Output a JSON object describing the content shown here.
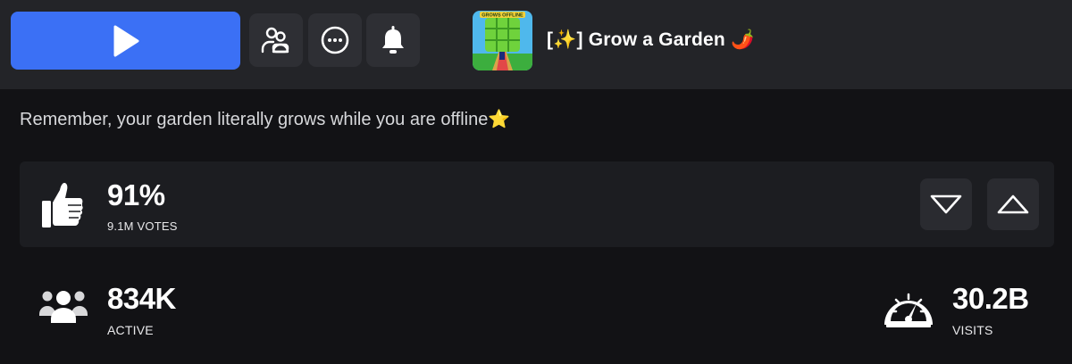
{
  "game": {
    "title": "[✨] Grow a Garden 🌶️",
    "thumbnail_caption": "GROWS OFFLINE",
    "description": "Remember, your garden literally grows while you are offline⭐"
  },
  "header": {
    "play_icon": "play-icon",
    "buttons": [
      {
        "icon": "party-icon"
      },
      {
        "icon": "more-options-icon"
      },
      {
        "icon": "bell-icon"
      }
    ]
  },
  "rating": {
    "percent": "91%",
    "votes": "9.1M VOTES",
    "icon": "thumbs-up-icon",
    "downvote_icon": "chevron-down-icon",
    "upvote_icon": "chevron-up-icon"
  },
  "stats": {
    "active": {
      "value": "834K",
      "label": "ACTIVE",
      "icon": "users-icon"
    },
    "visits": {
      "value": "30.2B",
      "label": "VISITS",
      "icon": "speedometer-icon"
    }
  },
  "colors": {
    "play_button": "#3b70f5",
    "header_bg": "#232428",
    "page_bg": "#121215",
    "panel_bg": "#1c1d21"
  }
}
